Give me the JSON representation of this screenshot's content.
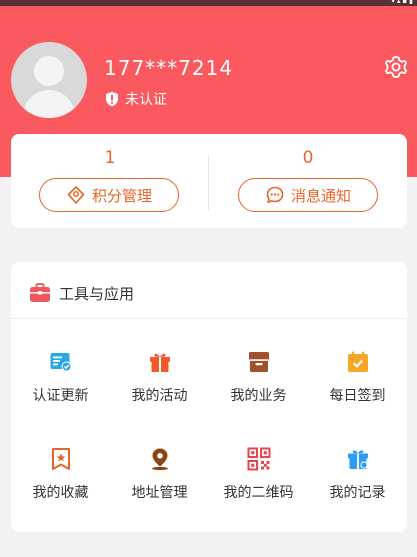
{
  "user": {
    "phone": "177***7214",
    "verify_status": "未认证"
  },
  "stats": {
    "points": {
      "value": "1",
      "label": "积分管理"
    },
    "messages": {
      "value": "0",
      "label": "消息通知"
    }
  },
  "tools": {
    "title": "工具与应用",
    "items": [
      {
        "label": "认证更新",
        "icon": "id-card-check-icon",
        "color": "#2aa7e6"
      },
      {
        "label": "我的活动",
        "icon": "gift-icon",
        "color": "#f05a28"
      },
      {
        "label": "我的业务",
        "icon": "archive-box-icon",
        "color": "#a0522d"
      },
      {
        "label": "每日签到",
        "icon": "calendar-check-icon",
        "color": "#f5a623"
      },
      {
        "label": "我的收藏",
        "icon": "bookmark-star-icon",
        "color": "#e8642a"
      },
      {
        "label": "地址管理",
        "icon": "location-pin-icon",
        "color": "#8b4513"
      },
      {
        "label": "我的二维码",
        "icon": "qr-code-icon",
        "color": "#e8464b"
      },
      {
        "label": "我的记录",
        "icon": "gift-box-record-icon",
        "color": "#2a9df4"
      }
    ]
  },
  "colors": {
    "header_bg": "#fa5a5f",
    "accent": "#e8642a",
    "page_bg": "#f2f2f2"
  }
}
